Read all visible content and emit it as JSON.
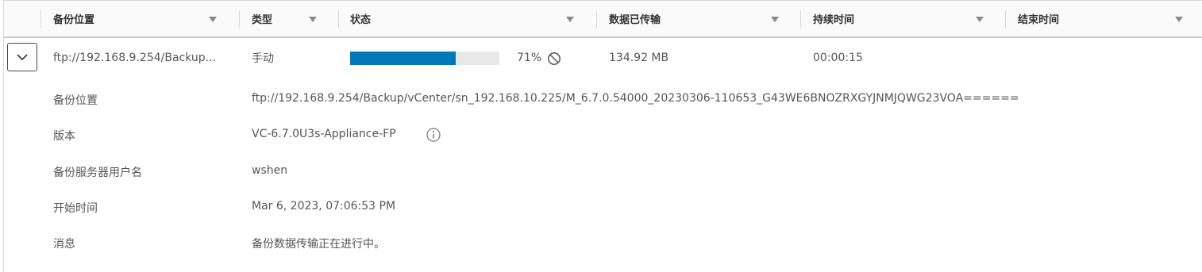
{
  "columns": [
    {
      "label": "备份位置"
    },
    {
      "label": "类型"
    },
    {
      "label": "状态"
    },
    {
      "label": "数据已传输"
    },
    {
      "label": "持续时间"
    },
    {
      "label": "结束时间"
    }
  ],
  "row": {
    "location_short": "ftp://192.168.9.254/Backup...",
    "type": "手动",
    "progress_fraction": 0.71,
    "progress_label": "71%",
    "data_transferred": "134.92 MB",
    "duration": "00:00:15",
    "end_time": ""
  },
  "details": {
    "location": {
      "label": "备份位置",
      "value": "ftp://192.168.9.254/Backup/vCenter/sn_192.168.10.225/M_6.7.0.54000_20230306-110653_G43WE6BNOZRXGYJNMJQWG23VOA======"
    },
    "version": {
      "label": "版本",
      "value": "VC-6.7.0U3s-Appliance-FP"
    },
    "user": {
      "label": "备份服务器用户名",
      "value": "wshen"
    },
    "start_time": {
      "label": "开始时间",
      "value": "Mar 6, 2023, 07:06:53 PM"
    },
    "message": {
      "label": "消息",
      "value": "备份数据传输正在进行中。"
    }
  },
  "icons": {
    "expand": "chevron-down-icon",
    "filter": "filter-icon",
    "cancel": "cancel-icon",
    "info": "info-icon"
  },
  "colors": {
    "progress": "#0079b8",
    "progress_track": "#e8e8e8"
  }
}
